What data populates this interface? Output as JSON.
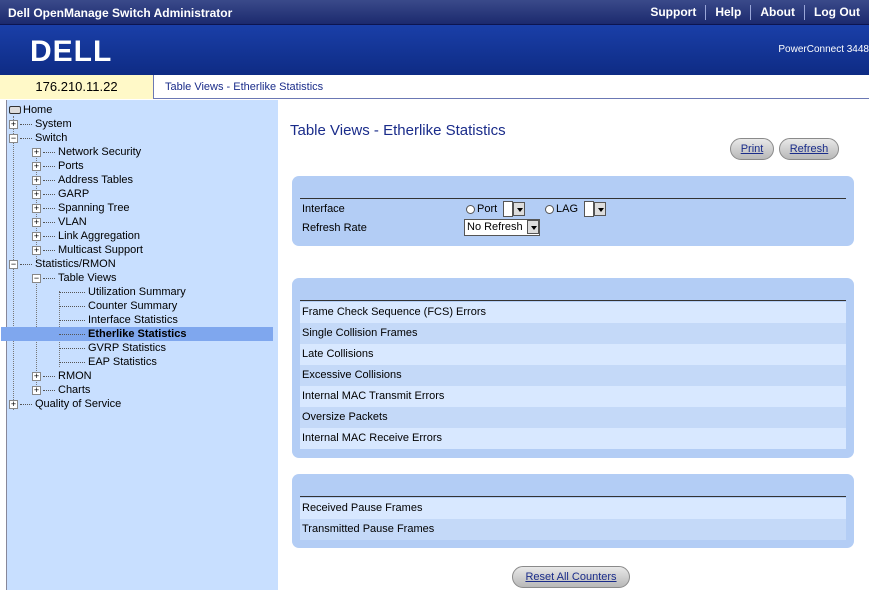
{
  "topbar": {
    "title": "Dell OpenManage Switch Administrator",
    "links": [
      "Support",
      "Help",
      "About",
      "Log Out"
    ]
  },
  "brand": {
    "logo": "DELL",
    "model": "PowerConnect 3448"
  },
  "ipbar": {
    "ip": "176.210.11.22",
    "breadcrumb": "Table Views - Etherlike Statistics"
  },
  "tree": {
    "home": "Home",
    "system": "System",
    "switch": "Switch",
    "network_security": "Network Security",
    "ports": "Ports",
    "address_tables": "Address Tables",
    "garp": "GARP",
    "spanning_tree": "Spanning Tree",
    "vlan": "VLAN",
    "link_aggregation": "Link Aggregation",
    "multicast_support": "Multicast Support",
    "statistics_rmon": "Statistics/RMON",
    "table_views": "Table Views",
    "utilization_summary": "Utilization Summary",
    "counter_summary": "Counter Summary",
    "interface_statistics": "Interface Statistics",
    "etherlike_statistics": "Etherlike Statistics",
    "gvrp_statistics": "GVRP Statistics",
    "eap_statistics": "EAP Statistics",
    "rmon": "RMON",
    "charts": "Charts",
    "quality_of_service": "Quality of Service"
  },
  "main": {
    "title": "Table Views - Etherlike Statistics",
    "print_label": "Print",
    "refresh_label": "Refresh",
    "interface_label": "Interface",
    "port_label": "Port",
    "lag_label": "LAG",
    "refresh_rate_label": "Refresh Rate",
    "refresh_rate_value": "No Refresh",
    "counters": [
      "Frame Check Sequence (FCS) Errors",
      "Single Collision Frames",
      "Late Collisions",
      "Excessive Collisions",
      "Internal MAC Transmit Errors",
      "Oversize Packets",
      "Internal MAC Receive Errors"
    ],
    "pause_counters": [
      "Received Pause Frames",
      "Transmitted Pause Frames"
    ],
    "reset_label": "Reset All Counters"
  }
}
